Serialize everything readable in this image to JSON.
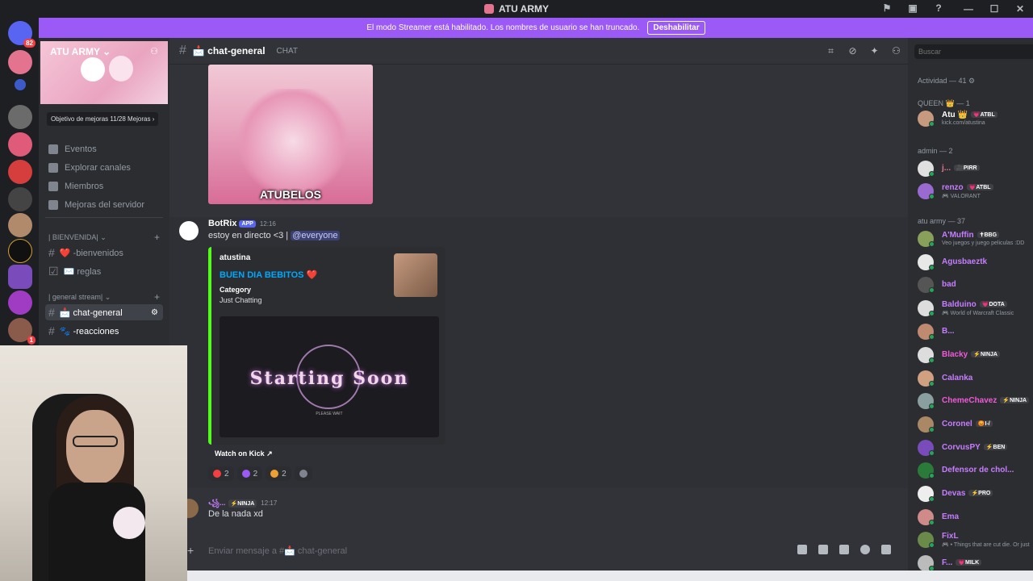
{
  "window": {
    "title": "ATU ARMY",
    "controls": [
      "—",
      "☐",
      "✕"
    ]
  },
  "banner": {
    "text": "El modo Streamer está habilitado. Los nombres de usuario se han truncado.",
    "button": "Deshabilitar"
  },
  "guilds": {
    "badge_top": "82",
    "badge_bottom": "1",
    "colors": [
      "#5865f2",
      "#e4738f",
      "#3c5bc9",
      "#6b6b6b",
      "#e05a7a",
      "#d63d3d",
      "#444",
      "#b08a6a",
      "#111",
      "#7a4cbb",
      "#a03cc4",
      "#8a5a4a"
    ]
  },
  "sidebar": {
    "server_name": "ATU ARMY",
    "boost": "Objetivo de mejoras  11/28 Mejoras  ›",
    "nav": [
      {
        "label": "Eventos",
        "icon": "calendar-icon"
      },
      {
        "label": "Explorar canales",
        "icon": "browse-icon"
      },
      {
        "label": "Miembros",
        "icon": "members-icon"
      },
      {
        "label": "Mejoras del servidor",
        "icon": "boost-icon"
      }
    ],
    "categories": [
      {
        "label": "| BIENVENIDA| ⌄",
        "channels": [
          "❤️ -bienvenidos",
          "✉️ reglas"
        ]
      },
      {
        "label": "| general stream| ⌄",
        "channels": [
          "📩 chat-general",
          "🐾 -reacciones"
        ]
      }
    ]
  },
  "chat": {
    "channel": "📩 chat-general",
    "topic": "CHAT",
    "gif_caption": "ATUBELOS",
    "messages": [
      {
        "author": "BotRix",
        "tag": "APP",
        "time": "12:16",
        "text": "estoy en directo <3 | ",
        "mention": "@everyone",
        "embed": {
          "author": "atustina",
          "title": "BUEN DIA BEBITOS ❤️",
          "field_name": "Category",
          "field_value": "Just Chatting",
          "image_text": "Starting Soon",
          "image_sub": "PLEASE WAIT",
          "button": "Watch on Kick  ↗"
        },
        "reactions": [
          {
            "count": "2",
            "color": "#f23f43"
          },
          {
            "count": "2",
            "color": "#9b59f5"
          },
          {
            "count": "2",
            "color": "#f0a030"
          }
        ]
      },
      {
        "author": "꧁...",
        "tag": "⚡NINJA",
        "time": "12:17",
        "text": "De la nada xd"
      }
    ],
    "composer_placeholder": "Enviar mensaje a #📩 chat-general"
  },
  "members": {
    "search_placeholder": "Buscar",
    "activity": "Actividad — 41 ⚙",
    "groups": [
      {
        "label": "QUEEN 👑 — 1"
      },
      {
        "label": "admin — 2"
      },
      {
        "label": "atu army — 37"
      }
    ],
    "list": [
      {
        "name": "Atu 👑",
        "tag": "💗ATBL",
        "sub": "kick.com/atustina",
        "color": "#ffffff",
        "av": "#c59a7f"
      },
      {
        "name": "j...",
        "tag": "🎥PIRR",
        "sub": "",
        "color": "#e4738f",
        "av": "#e0e0e0"
      },
      {
        "name": "renzo",
        "tag": "💗ATBL",
        "sub": "🎮 VALORANT",
        "color": "#c77dff",
        "av": "#9b6ad0"
      },
      {
        "name": "A'Muffin",
        "tag": "✝BBG",
        "sub": "Veo juegos y juego peliculas :DD",
        "color": "#c77dff",
        "av": "#88a05a"
      },
      {
        "name": "Agusbaeztk",
        "tag": "",
        "sub": "",
        "color": "#c77dff",
        "av": "#e8e8e8"
      },
      {
        "name": "bad",
        "tag": "",
        "sub": "",
        "color": "#c77dff",
        "av": "#555"
      },
      {
        "name": "Balduino",
        "tag": "💗DOTA",
        "sub": "🎮 World of Warcraft Classic",
        "color": "#c77dff",
        "av": "#ddd"
      },
      {
        "name": "B...",
        "tag": "",
        "sub": "",
        "color": "#c77dff",
        "av": "#c08a70"
      },
      {
        "name": "Blacky",
        "tag": "⚡NINJA",
        "sub": "",
        "color": "#f05ad8",
        "av": "#ddd"
      },
      {
        "name": "Calanka",
        "tag": "",
        "sub": "",
        "color": "#c77dff",
        "av": "#d0a080"
      },
      {
        "name": "ChemeChavez",
        "tag": "⚡NINJA",
        "sub": "",
        "color": "#f05ad8",
        "av": "#8aa0a0"
      },
      {
        "name": "Coronel",
        "tag": "😡I-/",
        "sub": "",
        "color": "#c77dff",
        "av": "#aa8866"
      },
      {
        "name": "CorvusPY",
        "tag": "⚡BEN",
        "sub": "",
        "color": "#c77dff",
        "av": "#7a4cbb"
      },
      {
        "name": "Defensor de chol...",
        "tag": "",
        "sub": "",
        "color": "#c77dff",
        "av": "#2a7a3a"
      },
      {
        "name": "Devas",
        "tag": "⚡PRO",
        "sub": "",
        "color": "#c77dff",
        "av": "#eee"
      },
      {
        "name": "Ema",
        "tag": "",
        "sub": "",
        "color": "#c77dff",
        "av": "#d08a8a"
      },
      {
        "name": "FixL",
        "tag": "",
        "sub": "🎮 • Things that are cut die. Or just",
        "color": "#c77dff",
        "av": "#6a8a4a"
      },
      {
        "name": "F...",
        "tag": "💗MILK",
        "sub": "",
        "color": "#c77dff",
        "av": "#bbb"
      }
    ]
  }
}
